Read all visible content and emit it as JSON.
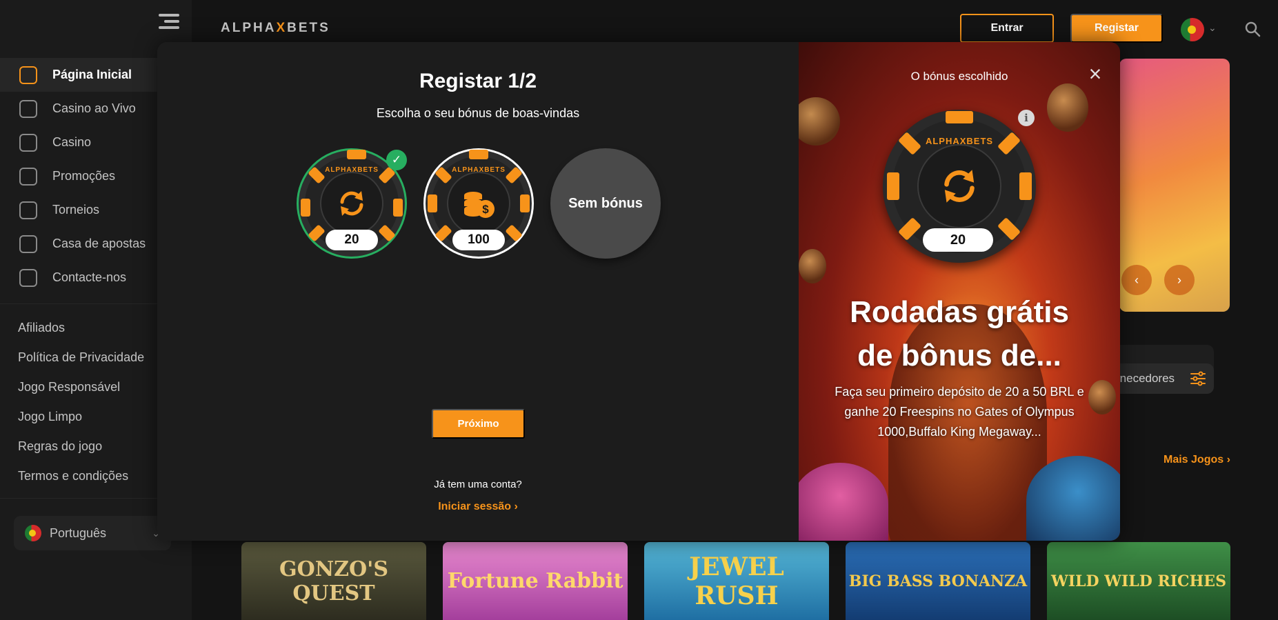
{
  "sidebar": {
    "menu": [
      {
        "label": "Página Inicial",
        "icon": "home-icon",
        "active": true
      },
      {
        "label": "Casino ao Vivo",
        "icon": "live-casino-icon"
      },
      {
        "label": "Casino",
        "icon": "slot-machine-icon"
      },
      {
        "label": "Promoções",
        "icon": "gift-icon"
      },
      {
        "label": "Torneios",
        "icon": "trophy-icon"
      },
      {
        "label": "Casa de apostas",
        "icon": "sports-ball-icon"
      },
      {
        "label": "Contacte-nos",
        "icon": "chat-icon"
      }
    ],
    "links": [
      "Afiliados",
      "Política de Privacidade",
      "Jogo Responsável",
      "Jogo Limpo",
      "Regras do jogo",
      "Termos e condições"
    ],
    "language": "Português"
  },
  "header": {
    "logo_left": "ALPHA",
    "logo_x": "X",
    "logo_right": "BETS",
    "login_label": "Entrar",
    "register_label": "Registar"
  },
  "page": {
    "providers_label": "rnecedores",
    "more_games_label": "Mais Jogos",
    "games": [
      "GONZO'S QUEST",
      "Fortune Rabbit",
      "JEWEL RUSH",
      "BIG BASS BONANZA",
      "WILD WILD RICHES"
    ]
  },
  "modal": {
    "title": "Registar 1/2",
    "subtitle": "Escolha o seu bónus de boas-vindas",
    "chip_brand": "ALPHAXBETS",
    "options": [
      {
        "value": "20",
        "icon": "refresh-icon",
        "selected": true
      },
      {
        "value": "100",
        "icon": "coins-dollar-icon",
        "selected": false
      }
    ],
    "no_bonus_label": "Sem bónus",
    "next_label": "Próximo",
    "have_account_label": "Já tem uma conta?",
    "login_label": "Iniciar sessão",
    "chosen_label": "O bónus escolhido",
    "chosen_value": "20",
    "bonus_heading_line1": "Rodadas grátis",
    "bonus_heading_line2": "de bônus de...",
    "bonus_description": "Faça seu primeiro depósito de 20 a 50 BRL e ganhe 20 Freespins no Gates of Olympus 1000,Buffalo King Megaway...",
    "accent_color": "#f7931a",
    "selected_color": "#27ae60"
  }
}
